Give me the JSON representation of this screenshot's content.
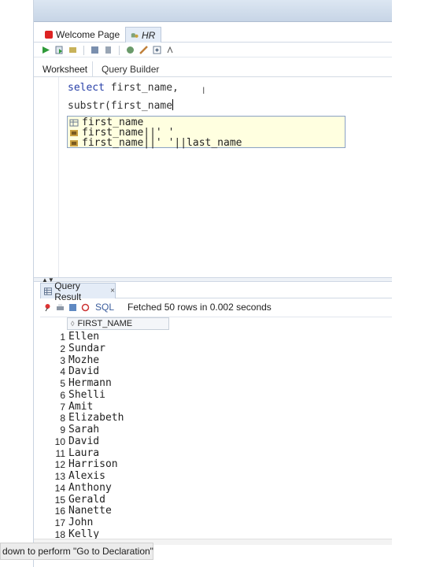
{
  "tabs": [
    {
      "label": "Welcome Page",
      "icon": "oracle-icon"
    },
    {
      "label": "HR",
      "icon": "database-connection-icon"
    }
  ],
  "subtabs": {
    "worksheet": "Worksheet",
    "query_builder": "Query Builder"
  },
  "editor": {
    "line1_keyword": "select",
    "line1_rest": " first_name,",
    "line2": "substr(first_name"
  },
  "autocomplete": {
    "items": [
      "first_name",
      "first_name||' '",
      "first_name||' '||last_name"
    ]
  },
  "query_result": {
    "tab_label": "Query Result",
    "close_label": "×",
    "sql_label": "SQL",
    "status": "Fetched 50 rows in 0.002 seconds",
    "column_header": "FIRST_NAME",
    "rows": [
      {
        "num": "1",
        "value": "Ellen"
      },
      {
        "num": "2",
        "value": "Sundar"
      },
      {
        "num": "3",
        "value": "Mozhe"
      },
      {
        "num": "4",
        "value": "David"
      },
      {
        "num": "5",
        "value": "Hermann"
      },
      {
        "num": "6",
        "value": "Shelli"
      },
      {
        "num": "7",
        "value": "Amit"
      },
      {
        "num": "8",
        "value": "Elizabeth"
      },
      {
        "num": "9",
        "value": "Sarah"
      },
      {
        "num": "10",
        "value": "David"
      },
      {
        "num": "11",
        "value": "Laura"
      },
      {
        "num": "12",
        "value": "Harrison"
      },
      {
        "num": "13",
        "value": "Alexis"
      },
      {
        "num": "14",
        "value": "Anthony"
      },
      {
        "num": "15",
        "value": "Gerald"
      },
      {
        "num": "16",
        "value": "Nanette"
      },
      {
        "num": "17",
        "value": "John"
      },
      {
        "num": "18",
        "value": "Kelly"
      }
    ]
  },
  "statusbar": {
    "text": "down to perform \"Go to Declaration\""
  },
  "colors": {
    "accent": "#2840a8",
    "popup_bg": "#ffffe0",
    "toolbar_bg": "#dce6f2"
  }
}
